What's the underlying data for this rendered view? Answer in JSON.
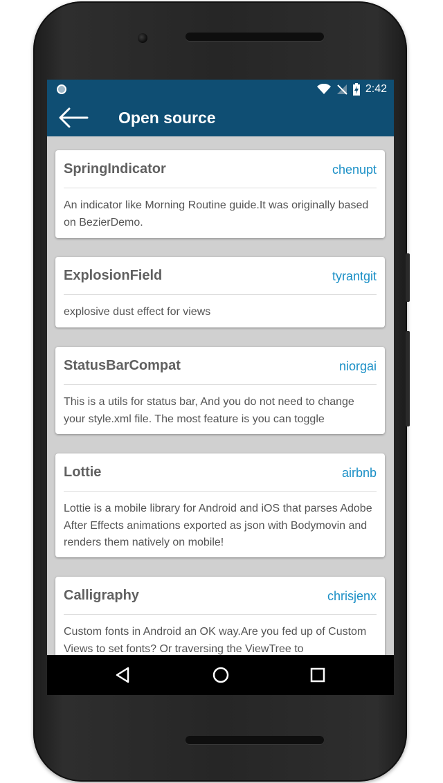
{
  "statusbar": {
    "time": "2:42"
  },
  "appbar": {
    "title": "Open source",
    "back_icon": "arrow-back-icon"
  },
  "projects": [
    {
      "title": "SpringIndicator",
      "author": "chenupt",
      "description": "An indicator like Morning Routine guide.It was originally based on BezierDemo."
    },
    {
      "title": "ExplosionField",
      "author": "tyrantgit",
      "description": "explosive dust effect for views"
    },
    {
      "title": "StatusBarCompat",
      "author": "niorgai",
      "description": "This is a utils for status bar, And you do not need to change your style.xml file. The most feature is you can toggle"
    },
    {
      "title": "Lottie",
      "author": "airbnb",
      "description": "Lottie is a mobile library for Android and iOS that parses Adobe After Effects animations exported as json with Bodymovin and renders them natively on mobile!"
    },
    {
      "title": "Calligraphy",
      "author": "chrisjenx",
      "description": "Custom fonts in Android an OK way.Are you fed up of Custom Views to set fonts? Or traversing the ViewTree to"
    }
  ],
  "navigation": {
    "back_icon": "nav-back-icon",
    "home_icon": "nav-home-icon",
    "recents_icon": "nav-recents-icon"
  },
  "colors": {
    "toolbar": "#0f4e73",
    "author_link": "#1a8fc6",
    "background": "#d0d0d0"
  }
}
